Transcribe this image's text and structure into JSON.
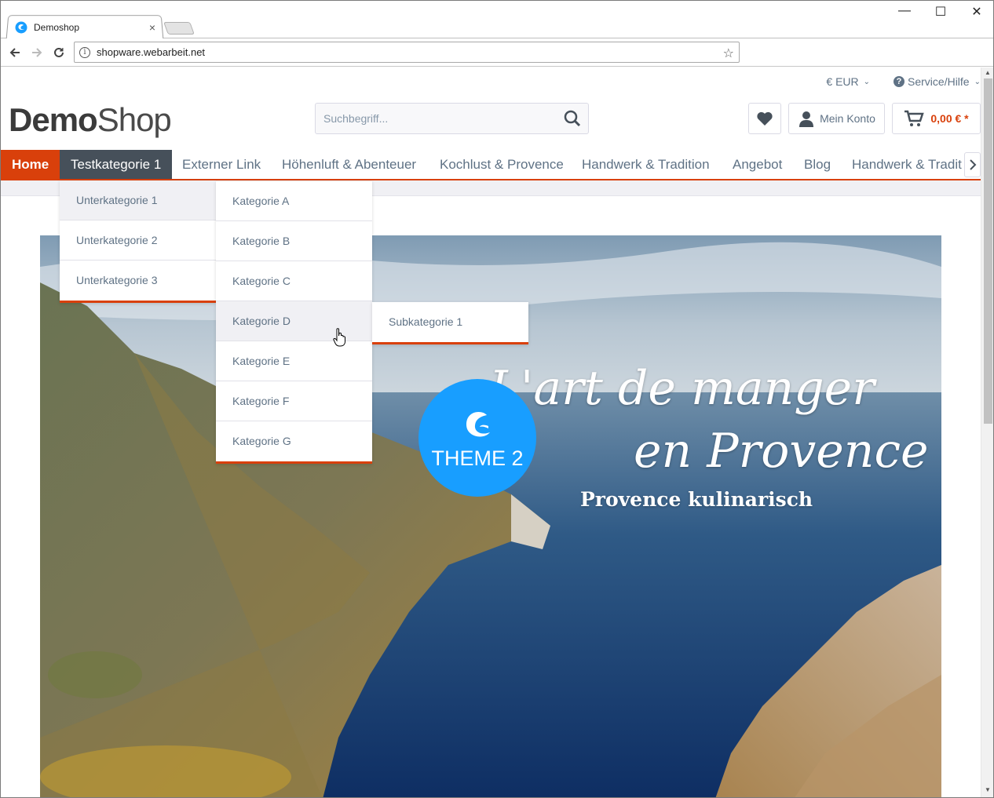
{
  "browser": {
    "tab_title": "Demoshop",
    "url": "shopware.webarbeit.net",
    "window_controls": [
      "minimize-icon",
      "maximize-icon",
      "close-icon"
    ]
  },
  "topbar": {
    "currency": "€ EUR",
    "service": "Service/Hilfe"
  },
  "header": {
    "logo_part1": "Demo",
    "logo_part2": "Shop",
    "search_placeholder": "Suchbegriff...",
    "account_label": "Mein Konto",
    "cart_value": "0,00 € *"
  },
  "nav": {
    "items": [
      "Home",
      "Testkategorie 1",
      "Externer Link",
      "Höhenluft & Abenteuer",
      "Kochlust & Provence",
      "Handwerk & Tradition",
      "Angebot",
      "Blog",
      "Handwerk & Tradit"
    ]
  },
  "dropdowns": {
    "level1": [
      "Unterkategorie 1",
      "Unterkategorie 2",
      "Unterkategorie 3"
    ],
    "level2": [
      "Kategorie A",
      "Kategorie B",
      "Kategorie C",
      "Kategorie D",
      "Kategorie E",
      "Kategorie F",
      "Kategorie G"
    ],
    "level3": [
      "Subkategorie 1"
    ]
  },
  "hero": {
    "title_line1": "L'art de manger",
    "title_line2": "en Provence",
    "subtitle": "Provence kulinarisch",
    "badge": "THEME 2"
  },
  "colors": {
    "accent": "#d9400b",
    "nav_active": "#46505a",
    "badge": "#189eff",
    "text": "#5f7285"
  }
}
